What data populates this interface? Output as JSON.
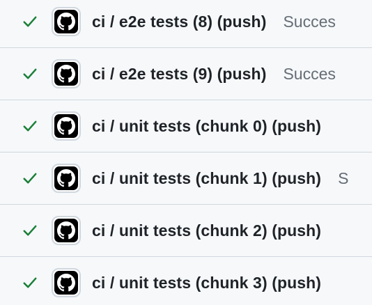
{
  "colors": {
    "success": "#1a7f37",
    "text_primary": "#1f2328",
    "text_muted": "#656d76",
    "border": "#d0d7de",
    "row_bg": "#f6f8fa"
  },
  "checks": [
    {
      "status_icon": "check-icon",
      "app_icon": "github-icon",
      "name": "ci / e2e tests (8) (push)",
      "status": "Succes"
    },
    {
      "status_icon": "check-icon",
      "app_icon": "github-icon",
      "name": "ci / e2e tests (9) (push)",
      "status": "Succes"
    },
    {
      "status_icon": "check-icon",
      "app_icon": "github-icon",
      "name": "ci / unit tests (chunk 0) (push)",
      "status": ""
    },
    {
      "status_icon": "check-icon",
      "app_icon": "github-icon",
      "name": "ci / unit tests (chunk 1) (push)",
      "status": "S"
    },
    {
      "status_icon": "check-icon",
      "app_icon": "github-icon",
      "name": "ci / unit tests (chunk 2) (push)",
      "status": ""
    },
    {
      "status_icon": "check-icon",
      "app_icon": "github-icon",
      "name": "ci / unit tests (chunk 3) (push)",
      "status": ""
    }
  ]
}
